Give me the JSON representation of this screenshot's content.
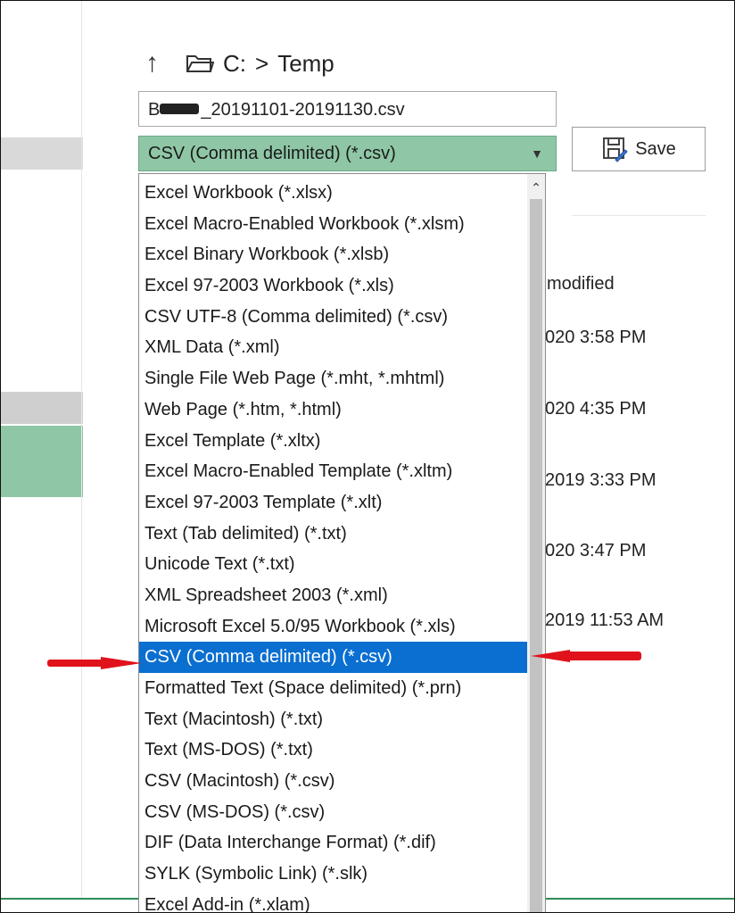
{
  "breadcrumb": {
    "drive": "C:",
    "sep": ">",
    "folder": "Temp"
  },
  "filename": {
    "value": "B_20191101-20191130.csv",
    "prefix": "B",
    "suffix": "_20191101-20191130.csv"
  },
  "save_type": {
    "selected": "CSV (Comma delimited) (*.csv)"
  },
  "save_button": {
    "label": "Save"
  },
  "file_list": {
    "header": "modified",
    "dates": [
      "020 3:58 PM",
      "020 4:35 PM",
      "2019 3:33 PM",
      "020 3:47 PM",
      "2019 11:53 AM"
    ]
  },
  "dropdown": {
    "selected_index": 15,
    "options": [
      "Excel Workbook (*.xlsx)",
      "Excel Macro-Enabled Workbook (*.xlsm)",
      "Excel Binary Workbook (*.xlsb)",
      "Excel 97-2003 Workbook (*.xls)",
      "CSV UTF-8 (Comma delimited) (*.csv)",
      "XML Data (*.xml)",
      "Single File Web Page (*.mht, *.mhtml)",
      "Web Page (*.htm, *.html)",
      "Excel Template (*.xltx)",
      "Excel Macro-Enabled Template (*.xltm)",
      "Excel 97-2003 Template (*.xlt)",
      "Text (Tab delimited) (*.txt)",
      "Unicode Text (*.txt)",
      "XML Spreadsheet 2003 (*.xml)",
      "Microsoft Excel 5.0/95 Workbook (*.xls)",
      "CSV (Comma delimited) (*.csv)",
      "Formatted Text (Space delimited) (*.prn)",
      "Text (Macintosh) (*.txt)",
      "Text (MS-DOS) (*.txt)",
      "CSV (Macintosh) (*.csv)",
      "CSV (MS-DOS) (*.csv)",
      "DIF (Data Interchange Format) (*.dif)",
      "SYLK (Symbolic Link) (*.slk)",
      "Excel Add-in (*.xlam)"
    ]
  },
  "colors": {
    "accent_green": "#8fc7a6",
    "selection_blue": "#0a6fd0",
    "annotation_red": "#e0121b"
  }
}
